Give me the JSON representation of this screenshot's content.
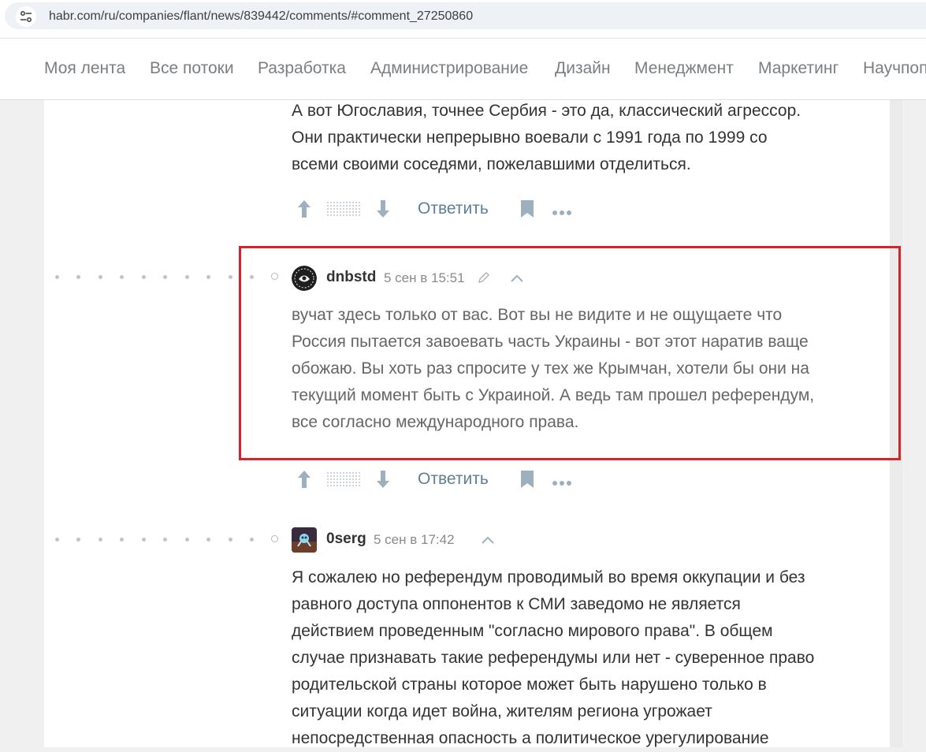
{
  "browser": {
    "url": "habr.com/ru/companies/flant/news/839442/comments/#comment_27250860"
  },
  "nav": {
    "items": [
      "Моя лента",
      "Все потоки",
      "Разработка",
      "Администрирование",
      "Дизайн",
      "Менеджмент",
      "Маркетинг",
      "Научпоп"
    ]
  },
  "comment_prev": {
    "lines": [
      "А вот Югославия, точнее Сербия - это да, классический агрессор.",
      "Они практически непрерывно воевали с 1991 года по 1999 со",
      "всеми своими соседями, пожелавшими отделиться."
    ]
  },
  "actions": {
    "reply_label": "Ответить"
  },
  "comment_main": {
    "author": "dnbstd",
    "date": "5 сен в 15:51",
    "lines": [
      "вучат здесь только от вас. Вот вы не видите и не ощущаете что",
      "Россия пытается завоевать часть Украины  - вот этот наратив ваще",
      "обожаю. Вы хоть раз спросите у тех же Крымчан, хотели бы они на",
      "текущий момент быть с Украиной. А ведь там прошел референдум,",
      "все согласно международного права."
    ]
  },
  "comment_next": {
    "author": "0serg",
    "date": "5 сен в 17:42",
    "lines": [
      "Я сожалею но референдум проводимый во время оккупации и без",
      "равного доступа оппонентов к СМИ заведомо не является",
      "действием проведенным \"согласно мирового права\". В общем",
      "случае признавать такие референдумы или нет - суверенное право",
      "родительской страны которое может быть нарушено только в",
      "ситуации когда идет война, жителям региона угрожает",
      "непосредственная опасность а политическое урегулирование"
    ]
  },
  "colors": {
    "highlight_border": "#d4232b",
    "link": "#5e7f97",
    "muted_text": "#666666"
  },
  "icons": [
    "site-info-icon",
    "arrow-up-icon",
    "arrow-down-icon",
    "bookmark-icon",
    "more-dots-icon",
    "edit-pencil-icon",
    "collapse-chevron-icon"
  ]
}
